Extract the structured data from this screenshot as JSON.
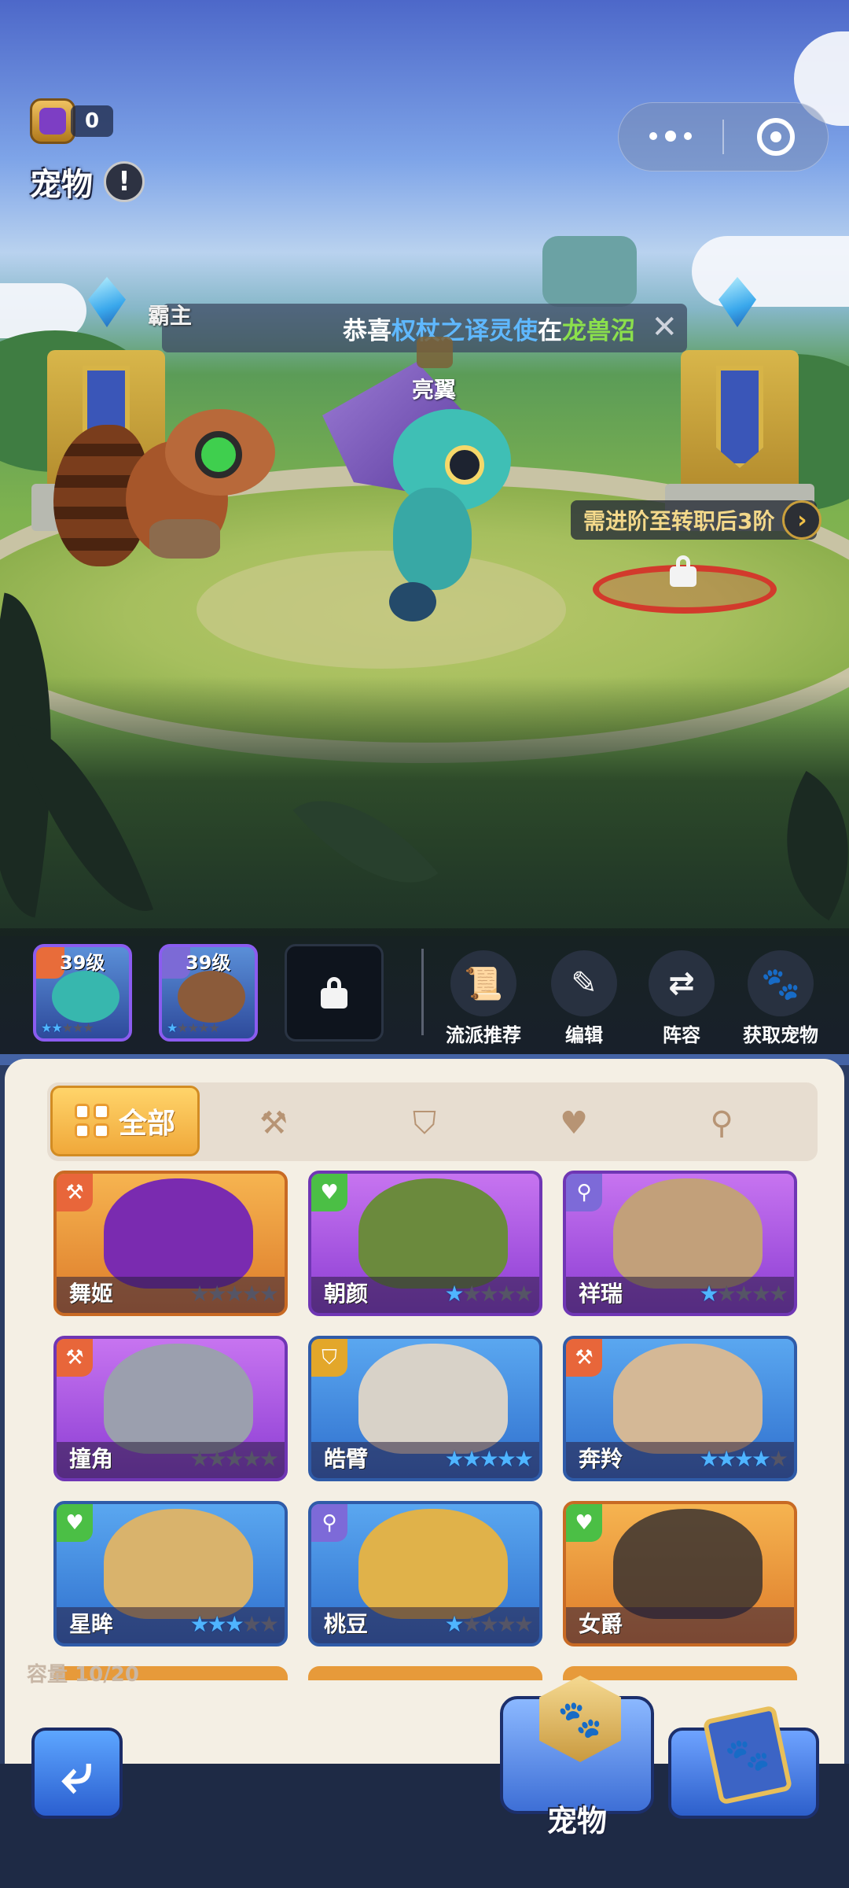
{
  "hud": {
    "coin_value": "0",
    "page_title": "宠物",
    "alert_glyph": "!"
  },
  "ticker": {
    "left_label": "霸主",
    "prefix": "恭喜",
    "player": "权杖之译灵使",
    "mid": "在",
    "place": "龙兽沼",
    "close_glyph": "✕"
  },
  "arena": {
    "center_pet_name": "亮翼",
    "slot_hint": "需进阶至转职后3阶",
    "slot_hint_arrow": "›"
  },
  "team": {
    "slots": [
      {
        "level": "39级",
        "stars_on": "★★",
        "stars_off": "★★★"
      },
      {
        "level": "39级",
        "stars_on": "★",
        "stars_off": "★★★★"
      }
    ],
    "actions": [
      {
        "label": "流派推荐",
        "icon": "scroll-icon",
        "glyph": "📜"
      },
      {
        "label": "编辑",
        "icon": "pencil-icon",
        "glyph": "✎"
      },
      {
        "label": "阵容",
        "icon": "swap-icon",
        "glyph": "⇄"
      },
      {
        "label": "获取宠物",
        "icon": "paw-icon",
        "glyph": "🐾"
      }
    ]
  },
  "filters": {
    "all_label": "全部",
    "tabs": [
      {
        "icon": "attack-class-icon",
        "glyph": "⚒"
      },
      {
        "icon": "defense-class-icon",
        "glyph": "⛉"
      },
      {
        "icon": "heal-class-icon",
        "glyph": "♥"
      },
      {
        "icon": "support-class-icon",
        "glyph": "⚲"
      }
    ]
  },
  "pets": [
    {
      "name": "舞姬",
      "stars_on": "",
      "stars_off": "★★★★★"
    },
    {
      "name": "朝颜",
      "stars_on": "★",
      "stars_off": "★★★★"
    },
    {
      "name": "祥瑞",
      "stars_on": "★",
      "stars_off": "★★★★"
    },
    {
      "name": "撞角",
      "stars_on": "",
      "stars_off": "★★★★★"
    },
    {
      "name": "皓臂",
      "stars_on": "★★★★★",
      "stars_off": ""
    },
    {
      "name": "奔羚",
      "stars_on": "★★★★",
      "stars_off": "★"
    },
    {
      "name": "星眸",
      "stars_on": "★★★",
      "stars_off": "★★"
    },
    {
      "name": "桃豆",
      "stars_on": "★",
      "stars_off": "★★★★"
    },
    {
      "name": "女爵",
      "stars_on": "",
      "stars_off": ""
    }
  ],
  "capacity": "容量 10/20",
  "nav": {
    "back_glyph": "⤶",
    "pet_label": "宠物",
    "pet_glyph": "🐾",
    "book_glyph": "🐾"
  }
}
